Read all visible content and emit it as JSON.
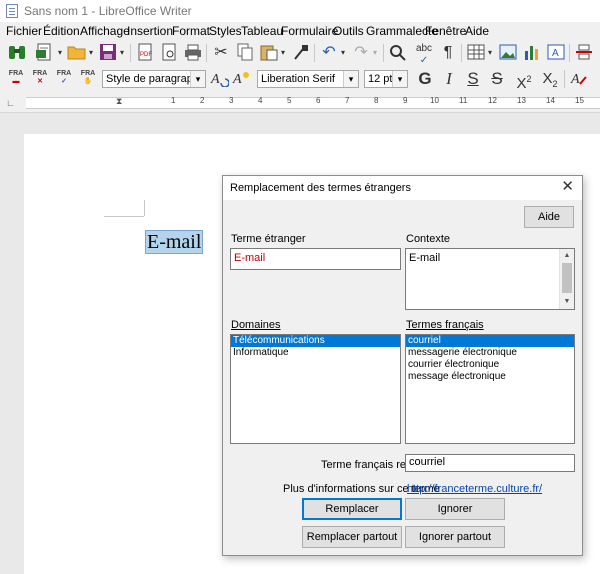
{
  "window": {
    "title": "Sans nom 1 - LibreOffice Writer"
  },
  "menu": [
    "Fichier",
    "Édition",
    "Affichage",
    "Insertion",
    "Format",
    "Styles",
    "Tableau",
    "Formulaire",
    "Outils",
    "Grammalecte",
    "Fenêtre",
    "Aide"
  ],
  "toolbar2": {
    "fra_labels": [
      "FRA",
      "FRA",
      "FRA",
      "FRA"
    ],
    "paragraph_style": "Style de paragraphe par",
    "font_name": "Liberation Serif",
    "font_size": "12 pt",
    "bold": "G",
    "italic": "I",
    "underline": "S",
    "strike": "S",
    "superscript_base": "X",
    "superscript_mark": "2",
    "subscript_base": "X",
    "subscript_mark": "2"
  },
  "ruler": {
    "numbers": [
      "1",
      "2",
      "3",
      "4",
      "5",
      "6",
      "7",
      "8",
      "9",
      "10",
      "11",
      "12",
      "13",
      "14",
      "15"
    ]
  },
  "document": {
    "selected_word": "E-mail"
  },
  "dialog": {
    "title": "Remplacement des termes étrangers",
    "help_button": "Aide",
    "foreign_term_label": "Terme étranger",
    "foreign_term_value": "E-mail",
    "context_label": "Contexte",
    "context_value": "E-mail",
    "domains_label": "Domaines",
    "domains": [
      "Télécommunications",
      "Informatique"
    ],
    "french_terms_label": "Termes français",
    "french_terms": [
      "courriel",
      "messagerie électronique",
      "courrier électronique",
      "message électronique"
    ],
    "retained_label": "Terme français retenu",
    "retained_value": "courriel",
    "more_info_label": "Plus d'informations sur ce terme",
    "more_info_link": "http://franceterme.culture.fr/",
    "replace_button": "Remplacer",
    "ignore_button": "Ignorer",
    "replace_all_button": "Remplacer partout",
    "ignore_all_button": "Ignorer partout",
    "error_color": "#c00000",
    "selection_color": "#0078d7"
  }
}
